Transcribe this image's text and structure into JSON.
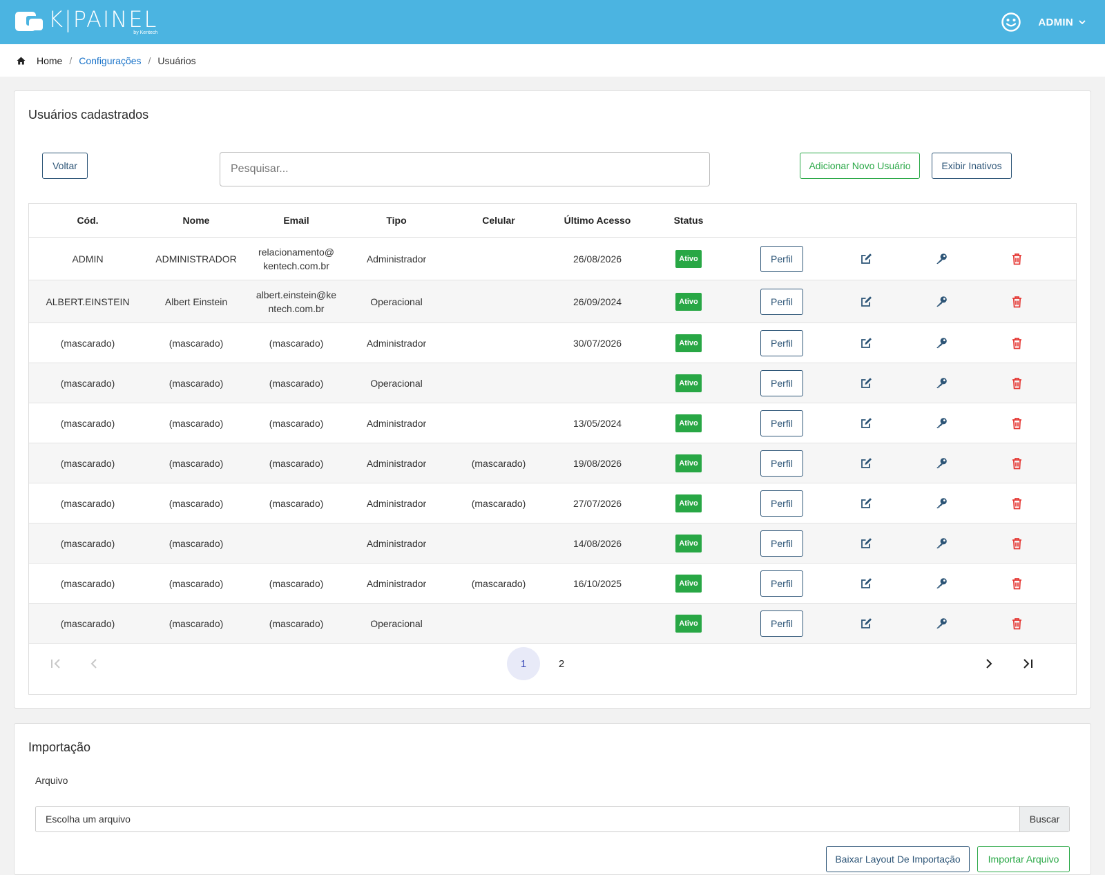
{
  "header": {
    "logo_text": "K|PAINEL",
    "logo_sub": "by Kentech",
    "user_name": "ADMIN"
  },
  "breadcrumb": {
    "home": "Home",
    "sep": "/",
    "config": "Configurações",
    "current": "Usuários"
  },
  "users": {
    "title": "Usuários cadastrados",
    "back_label": "Voltar",
    "search_placeholder": "Pesquisar...",
    "add_label": "Adicionar Novo Usuário",
    "inactive_label": "Exibir Inativos",
    "columns": [
      "Cód.",
      "Nome",
      "Email",
      "Tipo",
      "Celular",
      "Último Acesso",
      "Status"
    ],
    "profile_label": "Perfil",
    "rows": [
      {
        "code": "ADMIN",
        "name": "ADMINISTRADOR",
        "email": "relacionamento@\nkentech.com.br",
        "type": "Administrador",
        "phone": "",
        "last": "26/08/2026",
        "status": "Ativo"
      },
      {
        "code": "ALBERT.EINSTEIN",
        "name": "Albert Einstein",
        "email": "albert.einstein@ke\nntech.com.br",
        "type": "Operacional",
        "phone": "",
        "last": "26/09/2024",
        "status": "Ativo"
      },
      {
        "code": "(mascarado)",
        "name": "(mascarado)",
        "email": "(mascarado)",
        "type": "Administrador",
        "phone": "",
        "last": "30/07/2026",
        "status": "Ativo"
      },
      {
        "code": "(mascarado)",
        "name": "(mascarado)",
        "email": "(mascarado)",
        "type": "Operacional",
        "phone": "",
        "last": "",
        "status": "Ativo"
      },
      {
        "code": "(mascarado)",
        "name": "(mascarado)",
        "email": "(mascarado)",
        "type": "Administrador",
        "phone": "",
        "last": "13/05/2024",
        "status": "Ativo"
      },
      {
        "code": "(mascarado)",
        "name": "(mascarado)",
        "email": "(mascarado)",
        "type": "Administrador",
        "phone": "(mascarado)",
        "last": "19/08/2026",
        "status": "Ativo"
      },
      {
        "code": "(mascarado)",
        "name": "(mascarado)",
        "email": "(mascarado)",
        "type": "Administrador",
        "phone": "(mascarado)",
        "last": "27/07/2026",
        "status": "Ativo"
      },
      {
        "code": "(mascarado)",
        "name": "(mascarado)",
        "email": "",
        "type": "Administrador",
        "phone": "",
        "last": "14/08/2026",
        "status": "Ativo"
      },
      {
        "code": "(mascarado)",
        "name": "(mascarado)",
        "email": "(mascarado)",
        "type": "Administrador",
        "phone": "(mascarado)",
        "last": "16/10/2025",
        "status": "Ativo"
      },
      {
        "code": "(mascarado)",
        "name": "(mascarado)",
        "email": "(mascarado)",
        "type": "Operacional",
        "phone": "",
        "last": "",
        "status": "Ativo"
      }
    ],
    "pagination": {
      "pages": [
        "1",
        "2"
      ],
      "current": "1"
    }
  },
  "import": {
    "title": "Importação",
    "file_label": "Arquivo",
    "file_placeholder": "Escolha um arquivo",
    "browse_label": "Buscar",
    "layout_label": "Baixar Layout De Importação",
    "import_label": "Importar Arquivo"
  },
  "colors": {
    "header_bg": "#4bb4e1",
    "link": "#1a73c9",
    "navy": "#2d5577",
    "green": "#28a745",
    "delete": "#e53935"
  }
}
